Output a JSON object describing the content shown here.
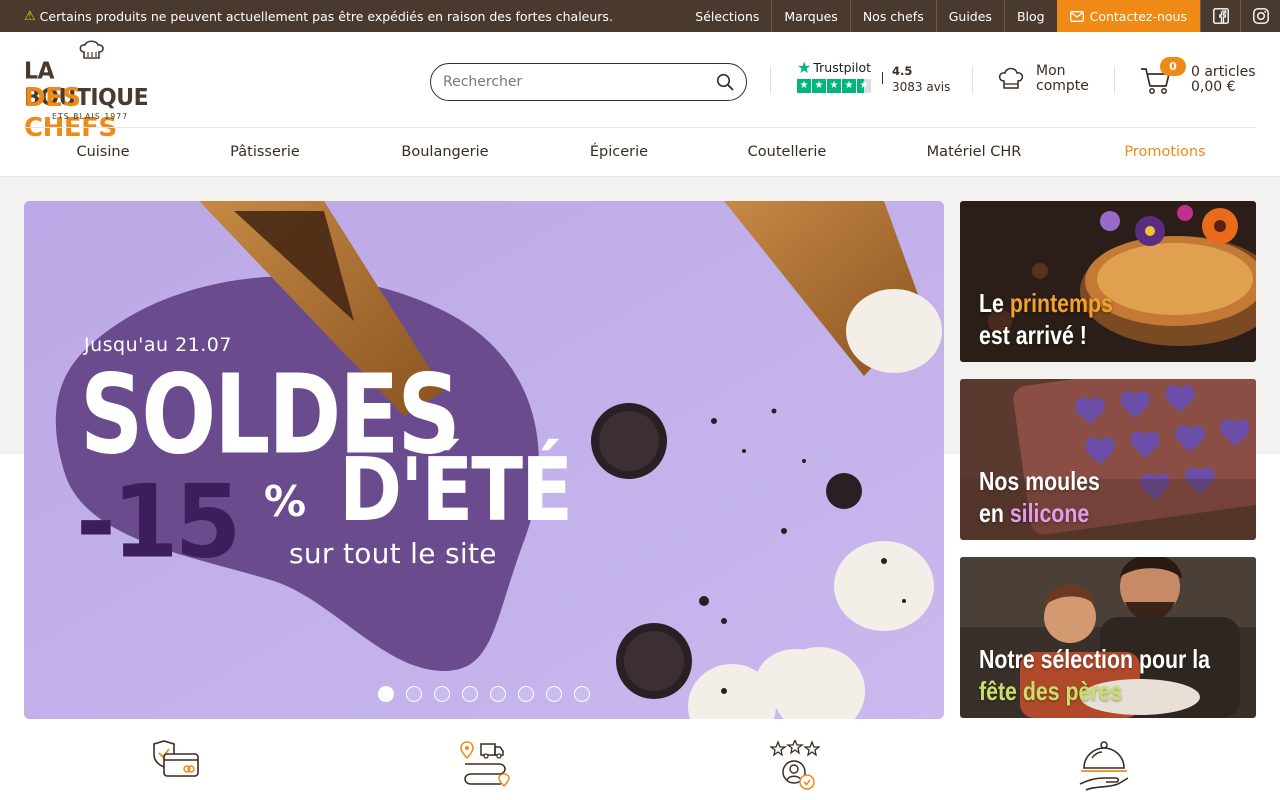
{
  "topbar": {
    "notice": "Certains produits ne peuvent actuellement pas être expédiés en raison des fortes chaleurs.",
    "links": [
      "Sélections",
      "Marques",
      "Nos chefs",
      "Guides",
      "Blog"
    ],
    "contact": "Contactez-nous",
    "social": [
      {
        "name": "facebook-icon"
      },
      {
        "name": "instagram-icon"
      }
    ]
  },
  "logo": {
    "line1": "LA BOUTIQUE",
    "line2": "DES CHEFS",
    "line3": "ETS BLAIS 1977"
  },
  "search": {
    "placeholder": "Rechercher",
    "value": ""
  },
  "trustpilot": {
    "brand": "Trustpilot",
    "rating": "4.5",
    "reviews": "3083 avis"
  },
  "account": {
    "line1": "Mon",
    "line2": "compte"
  },
  "cart": {
    "count": "0",
    "articles": "0 articles",
    "total": "0,00 €"
  },
  "nav": [
    {
      "label": "Cuisine"
    },
    {
      "label": "Pâtisserie"
    },
    {
      "label": "Boulangerie"
    },
    {
      "label": "Épicerie"
    },
    {
      "label": "Coutellerie"
    },
    {
      "label": "Matériel CHR"
    },
    {
      "label": "Promotions"
    }
  ],
  "hero": {
    "until": "Jusqu'au 21.07",
    "title1": "SOLDES",
    "title2": "D'ÉTÉ",
    "discount": "-15",
    "percent": "%",
    "subtitle": "sur tout le site",
    "slides_total": 8,
    "slide_active": 1
  },
  "side_promos": [
    {
      "line1_a": "Le ",
      "line1_b": "printemps",
      "line2": "est arrivé !"
    },
    {
      "line1": "Nos moules",
      "line2_a": "en ",
      "line2_b": "silicone"
    },
    {
      "line1": "Notre sélection pour la",
      "line2": "fête des pères"
    }
  ],
  "features": [
    {
      "icon": "secure-payment-icon"
    },
    {
      "icon": "delivery-route-icon"
    },
    {
      "icon": "customer-reviews-icon"
    },
    {
      "icon": "chef-service-icon"
    }
  ],
  "colors": {
    "brown": "#4a3a2e",
    "orange": "#ef8a17",
    "trustpilot_green": "#00b67a",
    "hero_purple": "#b8a6e3",
    "hero_dark": "#3d1e5c"
  }
}
